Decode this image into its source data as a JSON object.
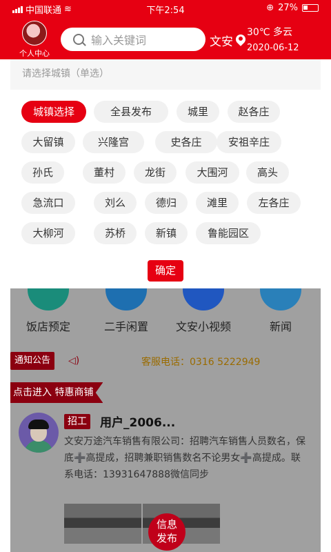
{
  "status_bar": {
    "carrier": "中国联通",
    "time": "下午2:54",
    "battery": "27%"
  },
  "header": {
    "user_center_label": "个人中心",
    "search_placeholder": "输入关键词",
    "city": "文安",
    "weather": "30℃ 多云",
    "date": "2020-06-12"
  },
  "town_panel": {
    "hint": "请选择城镇（单选）",
    "options": [
      "城镇选择",
      "全县发布",
      "城里",
      "赵各庄",
      "大留镇",
      "兴隆宫",
      "史各庄",
      "安祖辛庄",
      "孙氏",
      "董村",
      "龙街",
      "大围河",
      "高头",
      "急流口",
      "刘么",
      "德归",
      "滩里",
      "左各庄",
      "大柳河",
      "苏桥",
      "新镇",
      "鲁能园区"
    ],
    "selected": "城镇选择",
    "confirm_label": "确定"
  },
  "quick_links": [
    {
      "label": "饭店预定",
      "icon": "restaurant-icon",
      "color": "#1a8c7a"
    },
    {
      "label": "二手闲置",
      "icon": "second-hand-icon",
      "color": "#1e6fb0"
    },
    {
      "label": "文安小视频",
      "icon": "short-video-icon",
      "color": "#2057c0"
    },
    {
      "label": "新闻",
      "icon": "news-icon",
      "color": "#2a80b9"
    }
  ],
  "notice": {
    "tag": "通知公告",
    "service_phone": "客服电话：0316 5222949"
  },
  "special_shops_label": "点击进入 特惠商铺",
  "post": {
    "tag": "招工",
    "user": "用户_2006...",
    "text": "文安万途汽车销售有限公司：招聘汽车销售人员数名，保底➕高提成，招聘兼职销售数名不论男女➕高提成。联系电话：13931647888微信同步"
  },
  "publish_button": {
    "line1": "信息",
    "line2": "发布"
  },
  "colors": {
    "brand_red": "#e60012",
    "dark_red": "#8b0010",
    "phone_gold": "#9a6b00",
    "overlay_grey": "#a0a0a0"
  }
}
